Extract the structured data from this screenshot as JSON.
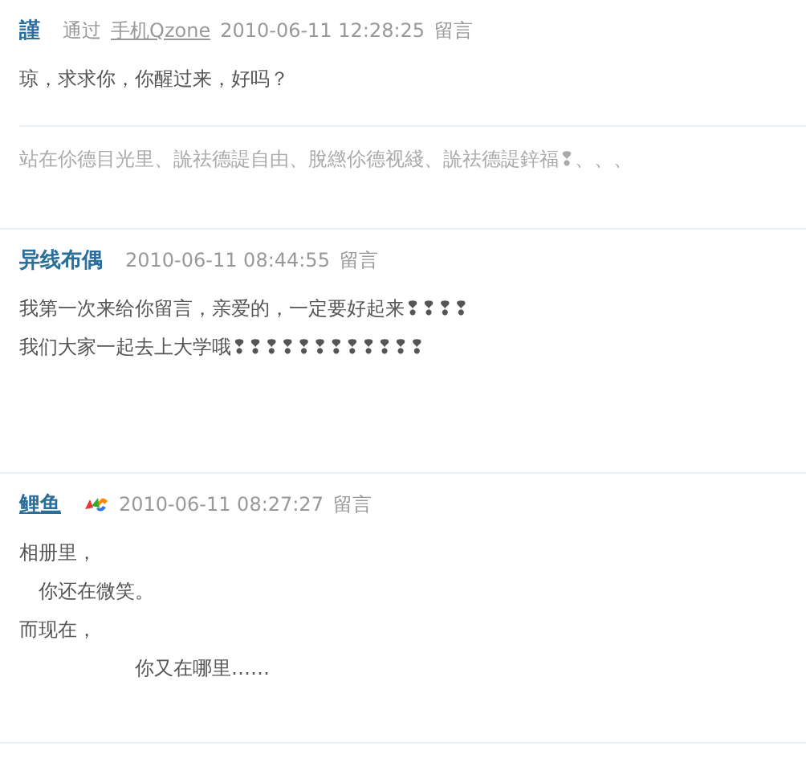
{
  "entries": [
    {
      "author": "謹",
      "underlined": false,
      "badge": false,
      "via": {
        "prefix": "通过",
        "link": "手机Qzone"
      },
      "time": "2010-06-11 12:28:25",
      "action": "留言",
      "lines": [
        "琼，求求你，你醒过来，好吗？"
      ],
      "signature": "站在伱德目光里、詤祛德諟自由、脫繺伱德视綫、詤祛德諟鋅福❢、、、"
    },
    {
      "author": "异线布偶",
      "underlined": false,
      "badge": false,
      "time": "2010-06-11 08:44:55",
      "action": "留言",
      "lines": [
        "我第一次来给你留言，亲爱的，一定要好起来❢❢❢❢",
        "我们大家一起去上大学哦❢❢❢❢❢❢❢❢❢❢❢❢"
      ]
    },
    {
      "author": "鲤鱼",
      "underlined": true,
      "badge": true,
      "time": "2010-06-11 08:27:27",
      "action": "留言",
      "lines": [
        "相册里，",
        "　你还在微笑。",
        "而现在，",
        "　　　　　　你又在哪里……"
      ]
    }
  ]
}
